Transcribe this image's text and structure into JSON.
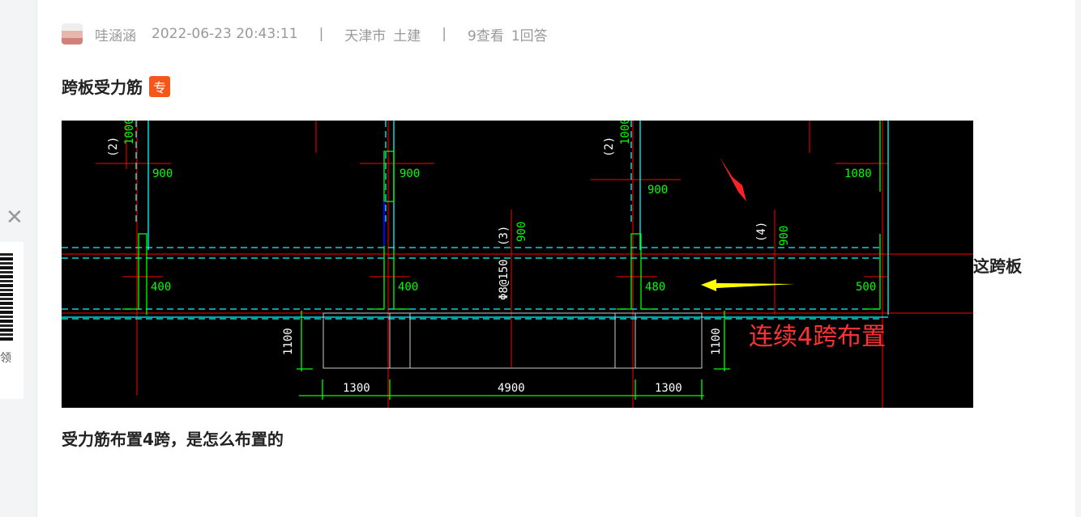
{
  "post": {
    "author": "哇涵涵",
    "datetime": "2022-06-23 20:43:11",
    "separator": "|",
    "location": "天津市",
    "category": "土建",
    "views": "9查看",
    "answers": "1回答",
    "title": "跨板受力筋",
    "badge": "专",
    "side_note": "这跨板",
    "body": "受力筋布置4跨，是怎么布置的"
  },
  "drawing": {
    "labels": [
      "1000",
      "(2)",
      "900",
      "900",
      "1000",
      "(2)",
      "900",
      "1080",
      "400",
      "400",
      "480",
      "500",
      "Φ8@150",
      "(3)",
      "900",
      "(4)",
      "900",
      "1100",
      "1100",
      "1300",
      "4900",
      "1300"
    ],
    "annotation": "连续4跨布置",
    "colors": {
      "rebar": "#00ff00",
      "axis": "#ff0000",
      "dashed": "#00ffff",
      "annotation": "#ff3333",
      "arrow": "#ffff00"
    }
  },
  "sidebar": {
    "close_icon": "close-icon",
    "qr_text": "领"
  }
}
